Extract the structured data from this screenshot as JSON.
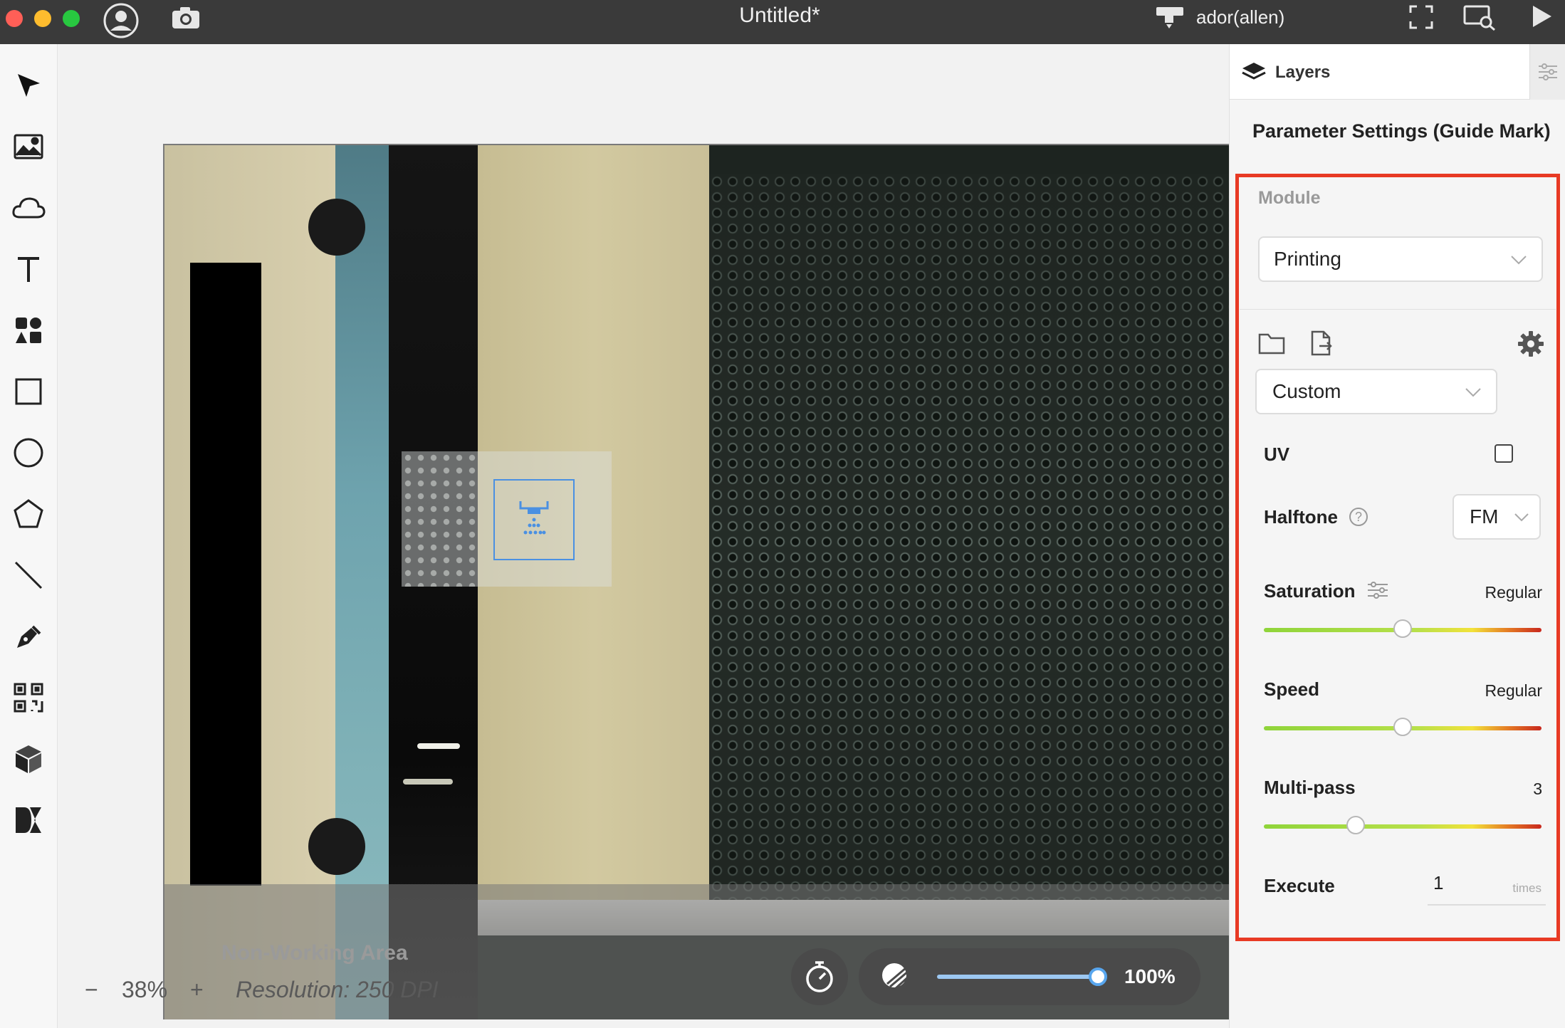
{
  "window": {
    "title": "Untitled*"
  },
  "titlebar": {
    "user": "ador(allen)"
  },
  "canvas": {
    "non_working_label": "Non-Working Area",
    "zoom_minus": "−",
    "zoom_value": "38%",
    "zoom_plus": "+",
    "resolution": "Resolution: 250 DPI",
    "opacity_value": "100%",
    "opacity_level": 1.0
  },
  "panel": {
    "tab_layers": "Layers",
    "title": "Parameter Settings (Guide Mark)",
    "module_label": "Module",
    "module_value": "Printing",
    "preset_value": "Custom",
    "uv_label": "UV",
    "uv_checked": false,
    "halftone_label": "Halftone",
    "halftone_value": "FM",
    "saturation_label": "Saturation",
    "saturation_value": "Regular",
    "saturation_level": 0.5,
    "speed_label": "Speed",
    "speed_value": "Regular",
    "speed_level": 0.5,
    "multipass_label": "Multi-pass",
    "multipass_value": "3",
    "multipass_level": 0.33,
    "execute_label": "Execute",
    "execute_value": "1",
    "execute_unit": "times"
  },
  "colors": {
    "highlight_border": "#e83a24",
    "accent_blue": "#4a90e2"
  }
}
